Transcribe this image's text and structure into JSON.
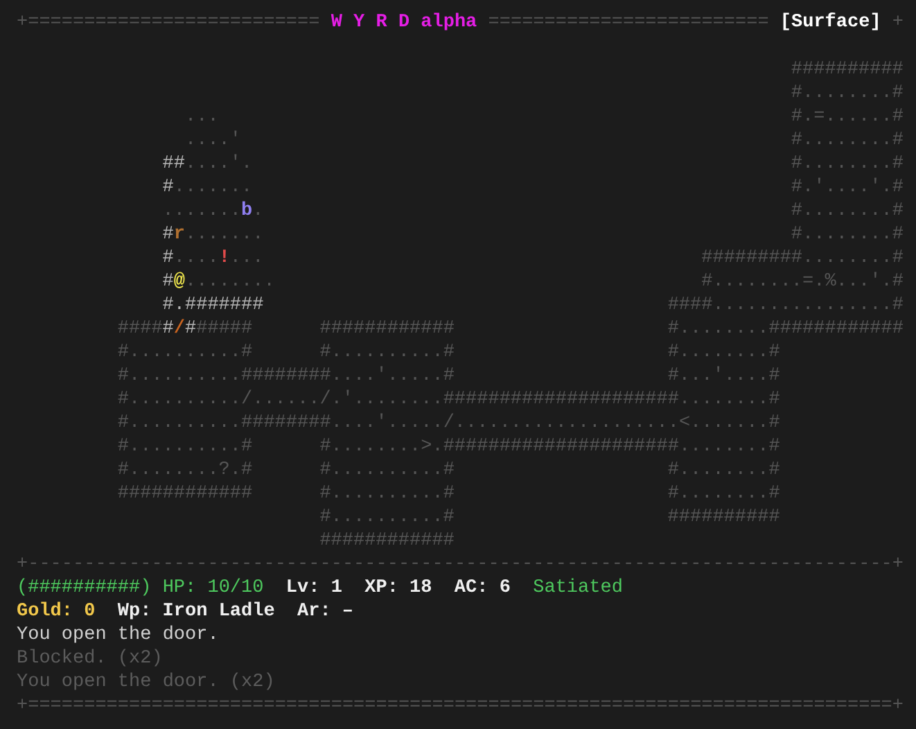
{
  "header": {
    "rule_left": "+==========================",
    "title": "W Y R D alpha",
    "rule_right": "=========================",
    "location": "[Surface]",
    "corner": "+"
  },
  "map": {
    "rows": [
      {
        "runs": [
          {
            "text": "                                                                     ##########",
            "kind": "tiles",
            "lit": false
          }
        ]
      },
      {
        "runs": [
          {
            "text": "                                                                     #........#",
            "kind": "tiles",
            "lit": false
          }
        ]
      },
      {
        "runs": [
          {
            "text": "               ...",
            "kind": "tiles",
            "lit": false
          },
          {
            "text": "                                                   #.=......#",
            "kind": "tiles",
            "lit": false
          }
        ]
      },
      {
        "runs": [
          {
            "text": "               ....'",
            "kind": "tiles",
            "lit": false
          },
          {
            "text": "                                                 #........#",
            "kind": "tiles",
            "lit": false
          }
        ]
      },
      {
        "runs": [
          {
            "text": "             ##",
            "kind": "tiles",
            "lit": true
          },
          {
            "text": "....'.",
            "kind": "tiles",
            "lit": false
          },
          {
            "text": "                                                #........#",
            "kind": "tiles",
            "lit": false
          }
        ]
      },
      {
        "runs": [
          {
            "text": "             #",
            "kind": "tiles",
            "lit": true
          },
          {
            "text": ".......",
            "kind": "tiles",
            "lit": false
          },
          {
            "text": "                                                #.'....'.#",
            "kind": "tiles",
            "lit": false
          }
        ]
      },
      {
        "runs": [
          {
            "text": "             .......",
            "kind": "tiles",
            "lit": false
          },
          {
            "text": "b",
            "kind": "monster",
            "color": "#8f7ff0"
          },
          {
            "text": ".",
            "kind": "tiles",
            "lit": false
          },
          {
            "text": "                                               #........#",
            "kind": "tiles",
            "lit": false
          }
        ]
      },
      {
        "runs": [
          {
            "text": "             #",
            "kind": "tiles",
            "lit": true
          },
          {
            "text": "r",
            "kind": "monster",
            "color": "#b07030"
          },
          {
            "text": ".......",
            "kind": "tiles",
            "lit": false
          },
          {
            "text": "                                               #........#",
            "kind": "tiles",
            "lit": false
          }
        ]
      },
      {
        "runs": [
          {
            "text": "             #",
            "kind": "tiles",
            "lit": true
          },
          {
            "text": "....",
            "kind": "tiles",
            "lit": false
          },
          {
            "text": "!",
            "kind": "item",
            "color": "#e04a4a"
          },
          {
            "text": "...",
            "kind": "tiles",
            "lit": false
          },
          {
            "text": "                                       #########........#",
            "kind": "tiles",
            "lit": false
          }
        ]
      },
      {
        "runs": [
          {
            "text": "             #",
            "kind": "tiles",
            "lit": true
          },
          {
            "text": "@",
            "kind": "player",
            "color": "#f2e94e"
          },
          {
            "text": "........",
            "kind": "tiles",
            "lit": false
          },
          {
            "text": "                                      #........=.%...'.#",
            "kind": "tiles",
            "lit": false
          }
        ]
      },
      {
        "runs": [
          {
            "text": "             #.#######",
            "kind": "tiles",
            "lit": true
          },
          {
            "text": "                                    ####................#",
            "kind": "tiles",
            "lit": false
          }
        ]
      },
      {
        "runs": [
          {
            "text": "         ####",
            "kind": "tiles",
            "lit": false
          },
          {
            "text": "#",
            "kind": "tiles",
            "lit": true
          },
          {
            "text": "/",
            "kind": "door",
            "color": "#c86420"
          },
          {
            "text": "#",
            "kind": "tiles",
            "lit": true
          },
          {
            "text": "#####",
            "kind": "tiles",
            "lit": false
          },
          {
            "text": "      ############",
            "kind": "tiles",
            "lit": false
          },
          {
            "text": "                   #........############",
            "kind": "tiles",
            "lit": false
          }
        ]
      },
      {
        "runs": [
          {
            "text": "         #..........#",
            "kind": "tiles",
            "lit": false
          },
          {
            "text": "      #..........#",
            "kind": "tiles",
            "lit": false
          },
          {
            "text": "                   #........#",
            "kind": "tiles",
            "lit": false
          }
        ]
      },
      {
        "runs": [
          {
            "text": "         #..........########....'.....#",
            "kind": "tiles",
            "lit": false
          },
          {
            "text": "                   #...'....#",
            "kind": "tiles",
            "lit": false
          }
        ]
      },
      {
        "runs": [
          {
            "text": "         #........../....../.'........#####################........#",
            "kind": "tiles",
            "lit": false
          }
        ]
      },
      {
        "runs": [
          {
            "text": "         #..........########....'...../....................<.......#",
            "kind": "tiles",
            "lit": false
          }
        ]
      },
      {
        "runs": [
          {
            "text": "         #..........#",
            "kind": "tiles",
            "lit": false
          },
          {
            "text": "      #........>.#####################........#",
            "kind": "tiles",
            "lit": false
          }
        ]
      },
      {
        "runs": [
          {
            "text": "         #........?.#",
            "kind": "tiles",
            "lit": false
          },
          {
            "text": "      #..........#",
            "kind": "tiles",
            "lit": false
          },
          {
            "text": "                   #........#",
            "kind": "tiles",
            "lit": false
          }
        ]
      },
      {
        "runs": [
          {
            "text": "         ############",
            "kind": "tiles",
            "lit": false
          },
          {
            "text": "      #..........#",
            "kind": "tiles",
            "lit": false
          },
          {
            "text": "                   #........#",
            "kind": "tiles",
            "lit": false
          }
        ]
      },
      {
        "runs": [
          {
            "text": "                           #..........#",
            "kind": "tiles",
            "lit": false
          },
          {
            "text": "                   ##########",
            "kind": "tiles",
            "lit": false
          }
        ]
      },
      {
        "runs": [
          {
            "text": "                           ############",
            "kind": "tiles",
            "lit": false
          }
        ]
      }
    ]
  },
  "divider": "+-----------------------------------------------------------------------------+",
  "status_lines": [
    [
      {
        "kind": "hp",
        "text": "(##########) HP: 10/10",
        "color": "#4ec95e"
      },
      {
        "kind": "level",
        "text": "Lv: 1",
        "color": "#f0f0f0"
      },
      {
        "kind": "xp",
        "text": "XP: 18",
        "color": "#f0f0f0"
      },
      {
        "kind": "ac",
        "text": "AC: 6",
        "color": "#f0f0f0"
      },
      {
        "kind": "hunger",
        "text": "Satiated",
        "color": "#4ec95e"
      }
    ],
    [
      {
        "kind": "gold",
        "text": "Gold: 0",
        "color": "#f2c84b"
      },
      {
        "kind": "weapon",
        "text": "Wp: Iron Ladle",
        "color": "#f0f0f0"
      },
      {
        "kind": "armor",
        "text": "Ar: –",
        "color": "#f0f0f0"
      }
    ]
  ],
  "messages": [
    {
      "text": "You open the door.",
      "recent": true
    },
    {
      "text": "Blocked. (x2)",
      "recent": false
    },
    {
      "text": "You open the door. (x2)",
      "recent": false
    }
  ],
  "footer": "+=============================================================================+"
}
